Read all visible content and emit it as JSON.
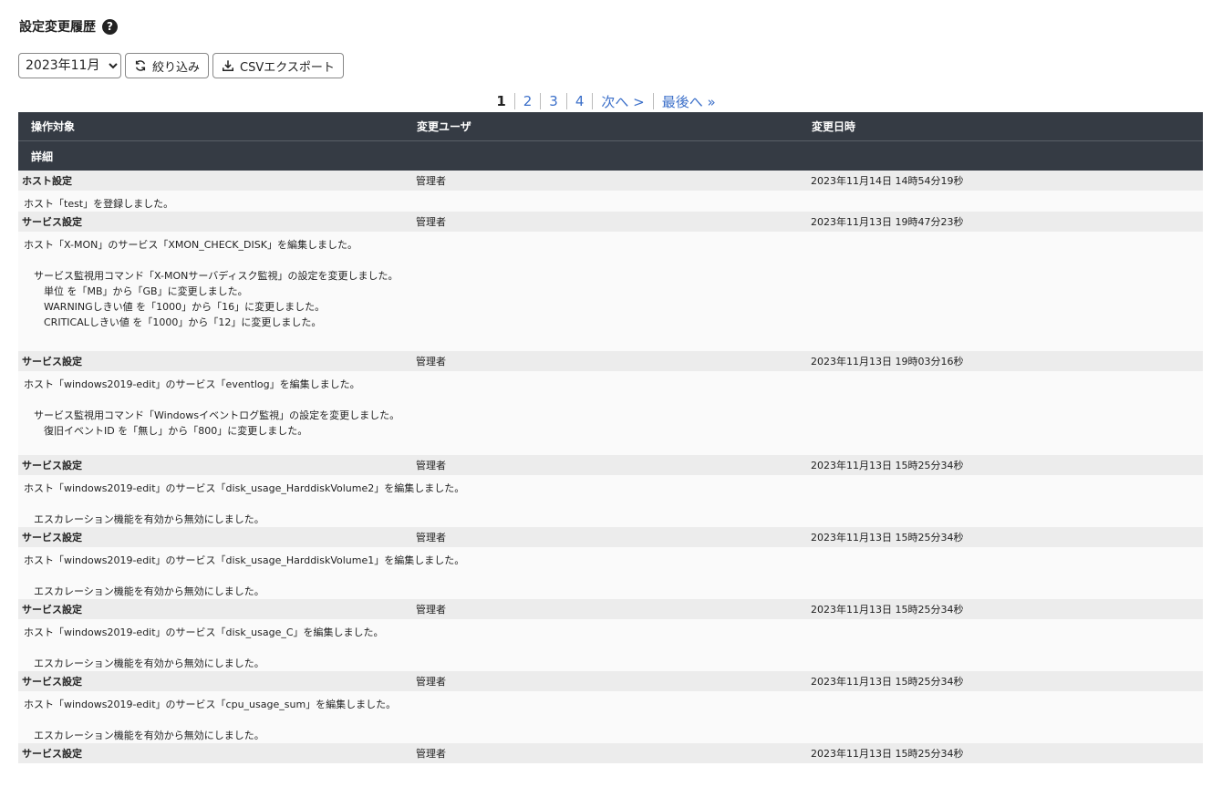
{
  "page": {
    "title": "設定変更履歴",
    "help_glyph": "?"
  },
  "toolbar": {
    "month_options": [
      "2023年11月"
    ],
    "month_selected": "2023年11月",
    "filter_label": "絞り込み",
    "export_label": "CSVエクスポート"
  },
  "pager": {
    "pages": [
      "1",
      "2",
      "3",
      "4"
    ],
    "current": "1",
    "next": "次へ >",
    "last": "最後へ »"
  },
  "table": {
    "headers": {
      "target": "操作対象",
      "user": "変更ユーザ",
      "datetime": "変更日時",
      "detail": "詳細"
    },
    "rows": [
      {
        "target": "ホスト設定",
        "user": "管理者",
        "datetime": "2023年11月14日 14時54分19秒",
        "detail": [
          {
            "text": "ホスト「test」を登録しました。",
            "indent": 0
          }
        ]
      },
      {
        "target": "サービス設定",
        "user": "管理者",
        "datetime": "2023年11月13日 19時47分23秒",
        "detail": [
          {
            "text": "ホスト「X-MON」のサービス「XMON_CHECK_DISK」を編集しました。",
            "indent": 0
          },
          {
            "text": "",
            "indent": 0
          },
          {
            "text": "サービス監視用コマンド「X-MONサーバディスク監視」の設定を変更しました。",
            "indent": 1
          },
          {
            "text": "単位 を「MB」から「GB」に変更しました。",
            "indent": 2
          },
          {
            "text": "WARNINGしきい値 を「1000」から「16」に変更しました。",
            "indent": 2
          },
          {
            "text": "CRITICALしきい値 を「1000」から「12」に変更しました。",
            "indent": 2
          }
        ]
      },
      {
        "target": "サービス設定",
        "user": "管理者",
        "datetime": "2023年11月13日 19時03分16秒",
        "detail": [
          {
            "text": "ホスト「windows2019-edit」のサービス「eventlog」を編集しました。",
            "indent": 0
          },
          {
            "text": "",
            "indent": 0
          },
          {
            "text": "サービス監視用コマンド「Windowsイベントログ監視」の設定を変更しました。",
            "indent": 1
          },
          {
            "text": "復旧イベントID を「無し」から「800」に変更しました。",
            "indent": 2
          }
        ]
      },
      {
        "target": "サービス設定",
        "user": "管理者",
        "datetime": "2023年11月13日 15時25分34秒",
        "detail": [
          {
            "text": "ホスト「windows2019-edit」のサービス「disk_usage_HarddiskVolume2」を編集しました。",
            "indent": 0
          },
          {
            "text": "",
            "indent": 0
          },
          {
            "text": "エスカレーション機能を有効から無効にしました。",
            "indent": 1
          }
        ]
      },
      {
        "target": "サービス設定",
        "user": "管理者",
        "datetime": "2023年11月13日 15時25分34秒",
        "detail": [
          {
            "text": "ホスト「windows2019-edit」のサービス「disk_usage_HarddiskVolume1」を編集しました。",
            "indent": 0
          },
          {
            "text": "",
            "indent": 0
          },
          {
            "text": "エスカレーション機能を有効から無効にしました。",
            "indent": 1
          }
        ]
      },
      {
        "target": "サービス設定",
        "user": "管理者",
        "datetime": "2023年11月13日 15時25分34秒",
        "detail": [
          {
            "text": "ホスト「windows2019-edit」のサービス「disk_usage_C」を編集しました。",
            "indent": 0
          },
          {
            "text": "",
            "indent": 0
          },
          {
            "text": "エスカレーション機能を有効から無効にしました。",
            "indent": 1
          }
        ]
      },
      {
        "target": "サービス設定",
        "user": "管理者",
        "datetime": "2023年11月13日 15時25分34秒",
        "detail": [
          {
            "text": "ホスト「windows2019-edit」のサービス「cpu_usage_sum」を編集しました。",
            "indent": 0
          },
          {
            "text": "",
            "indent": 0
          },
          {
            "text": "エスカレーション機能を有効から無効にしました。",
            "indent": 1
          }
        ]
      },
      {
        "target": "サービス設定",
        "user": "管理者",
        "datetime": "2023年11月13日 15時25分34秒",
        "detail": []
      }
    ]
  }
}
